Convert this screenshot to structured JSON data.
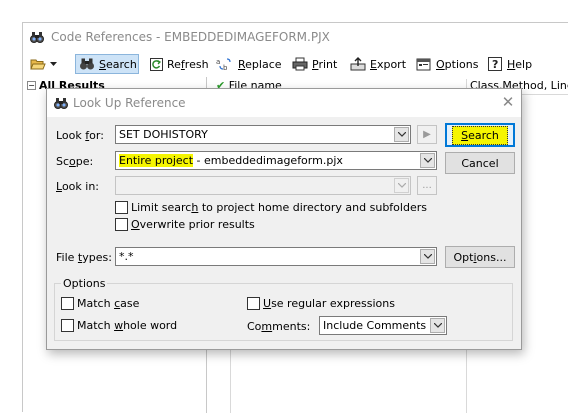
{
  "window": {
    "title": "Code References - EMBEDDEDIMAGEFORM.PJX"
  },
  "toolbar": {
    "search_label_prefix": "",
    "search_accel": "S",
    "search_rest": "earch",
    "refresh_pre": "Re",
    "refresh_accel": "f",
    "refresh_post": "resh",
    "replace_accel": "R",
    "replace_rest": "eplace",
    "print_accel": "P",
    "print_rest": "rint",
    "export_accel": "E",
    "export_rest": "xport",
    "options_accel": "O",
    "options_rest": "ptions",
    "help_accel": "H",
    "help_rest": "elp"
  },
  "tree": {
    "root_label": "All Results",
    "expander": "−"
  },
  "list": {
    "columns": [
      "File name",
      "Class.Method, Line"
    ]
  },
  "dialog": {
    "title": "Look Up Reference",
    "close_glyph": "✕",
    "look_for": {
      "label_pre": "Look ",
      "label_accel": "f",
      "label_post": "or:",
      "value": "SET DOHISTORY"
    },
    "scope": {
      "label_pre": "Sc",
      "label_accel": "o",
      "label_post": "pe:",
      "value_highlight": "Entire project",
      "value_rest": " - embeddedimageform.pjx"
    },
    "look_in": {
      "label_pre": "",
      "label_accel": "L",
      "label_post": "ook in:",
      "value": "",
      "browse_label": "..."
    },
    "limit_search": {
      "pre": "Limit searc",
      "accel": "h",
      "post": " to project home directory and subfolders",
      "checked": false
    },
    "overwrite": {
      "pre": "",
      "accel": "O",
      "post": "verwrite prior results",
      "checked": false
    },
    "file_types": {
      "label_pre": "File ",
      "label_accel": "t",
      "label_post": "ypes:",
      "value": "*.*"
    },
    "buttons": {
      "search_accel": "S",
      "search_rest": "earch",
      "cancel": "Cancel",
      "options_pre": "Opt",
      "options_accel": "i",
      "options_post": "ons...",
      "arrow": "▶"
    },
    "options_group": {
      "legend": "Options",
      "match_case_pre": "Match ",
      "match_case_accel": "c",
      "match_case_post": "ase",
      "match_whole_pre": "Match ",
      "match_whole_accel": "w",
      "match_whole_post": "hole word",
      "use_regex_pre": "",
      "use_regex_accel": "U",
      "use_regex_post": "se regular expressions",
      "comments_label_pre": "Co",
      "comments_label_accel": "m",
      "comments_label_post": "ments:",
      "comments_value": "Include Comments"
    }
  },
  "colors": {
    "highlight": "#f5f500",
    "accent": "#0078d7"
  }
}
